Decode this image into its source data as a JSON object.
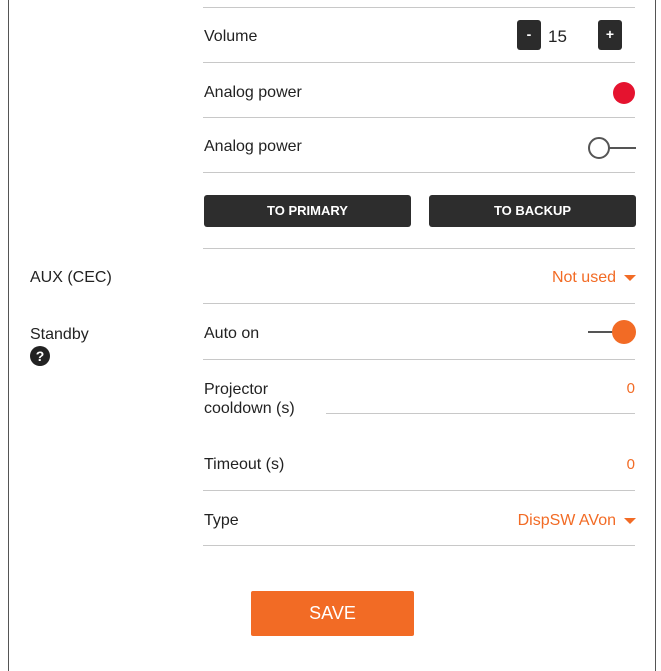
{
  "volume": {
    "label": "Volume",
    "value": "15",
    "minus": "-",
    "plus": "+"
  },
  "analog_power_1": {
    "label": "Analog power",
    "indicator": "red-dot-icon"
  },
  "analog_power_2": {
    "label": "Analog power",
    "toggle": "off"
  },
  "buttons": {
    "to_primary": "TO PRIMARY",
    "to_backup": "TO BACKUP"
  },
  "aux": {
    "label": "AUX (CEC)",
    "value": "Not used"
  },
  "standby": {
    "label": "Standby",
    "help": "?",
    "auto_on": {
      "label": "Auto on",
      "toggle": "on"
    },
    "projector_cooldown": {
      "label_line1": "Projector",
      "label_line2": "cooldown (s)",
      "value": "0"
    },
    "timeout": {
      "label": "Timeout (s)",
      "value": "0"
    },
    "type": {
      "label": "Type",
      "value": "DispSW AVon"
    }
  },
  "save": {
    "label": "SAVE"
  },
  "colors": {
    "accent": "#f26b25",
    "dark": "#2d2d2d",
    "indicator_red": "#e5132f"
  }
}
